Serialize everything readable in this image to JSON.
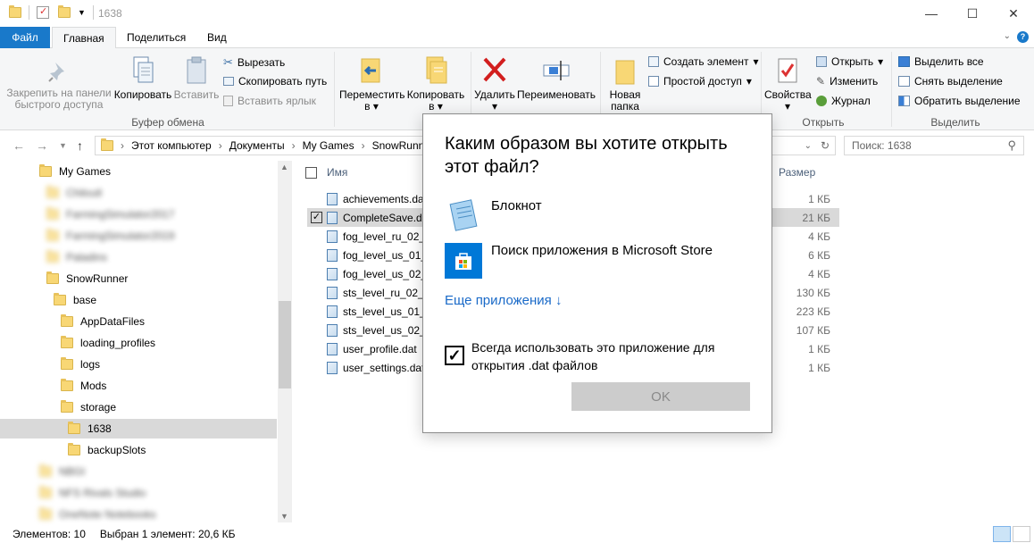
{
  "window": {
    "title": "1638",
    "controls": {
      "minimize": "—",
      "maximize": "☐",
      "close": "✕"
    }
  },
  "tabs": {
    "file": "Файл",
    "home": "Главная",
    "share": "Поделиться",
    "view": "Вид"
  },
  "ribbon": {
    "clipboard": {
      "pin": "Закрепить на панели быстрого доступа",
      "copy": "Копировать",
      "paste": "Вставить",
      "cut": "Вырезать",
      "copy_path": "Скопировать путь",
      "paste_shortcut": "Вставить ярлык",
      "label": "Буфер обмена"
    },
    "organize": {
      "move": "Переместить в",
      "copy_to": "Копировать в",
      "delete": "Удалить",
      "rename": "Переименовать"
    },
    "create": {
      "new_folder": "Новая папка",
      "new_item": "Создать элемент",
      "easy_access": "Простой доступ"
    },
    "open": {
      "properties": "Свойства",
      "open": "Открыть",
      "edit": "Изменить",
      "history": "Журнал",
      "label": "Открыть"
    },
    "select": {
      "select_all": "Выделить все",
      "select_none": "Снять выделение",
      "invert": "Обратить выделение",
      "label": "Выделить"
    }
  },
  "address": {
    "crumbs": [
      "Этот компьютер",
      "Документы",
      "My Games",
      "SnowRunner"
    ],
    "search_placeholder": "Поиск: 1638"
  },
  "tree": [
    {
      "label": "My Games",
      "indent": 0,
      "blur": false,
      "selected": false
    },
    {
      "label": "Chiloutl",
      "indent": 1,
      "blur": true,
      "selected": false
    },
    {
      "label": "FarmingSimulator2017",
      "indent": 1,
      "blur": true,
      "selected": false
    },
    {
      "label": "FarmingSimulator2019",
      "indent": 1,
      "blur": true,
      "selected": false
    },
    {
      "label": "Paladins",
      "indent": 1,
      "blur": true,
      "selected": false
    },
    {
      "label": "SnowRunner",
      "indent": 1,
      "blur": false,
      "selected": false
    },
    {
      "label": "base",
      "indent": 2,
      "blur": false,
      "selected": false
    },
    {
      "label": "AppDataFiles",
      "indent": 3,
      "blur": false,
      "selected": false
    },
    {
      "label": "loading_profiles",
      "indent": 3,
      "blur": false,
      "selected": false
    },
    {
      "label": "logs",
      "indent": 3,
      "blur": false,
      "selected": false
    },
    {
      "label": "Mods",
      "indent": 3,
      "blur": false,
      "selected": false
    },
    {
      "label": "storage",
      "indent": 3,
      "blur": false,
      "selected": false
    },
    {
      "label": "1638",
      "indent": 4,
      "blur": false,
      "selected": true
    },
    {
      "label": "backupSlots",
      "indent": 4,
      "blur": false,
      "selected": false
    },
    {
      "label": "NBGI",
      "indent": 0,
      "blur": true,
      "selected": false
    },
    {
      "label": "NFS Rivals Studio",
      "indent": 0,
      "blur": true,
      "selected": false
    },
    {
      "label": "OneNote Notebooks",
      "indent": 0,
      "blur": true,
      "selected": false
    }
  ],
  "list": {
    "col_name": "Имя",
    "col_size": "Размер",
    "files": [
      {
        "name": "achievements.dat",
        "size": "1 КБ",
        "selected": false,
        "checked": false
      },
      {
        "name": "CompleteSave.dat",
        "size": "21 КБ",
        "selected": true,
        "checked": true
      },
      {
        "name": "fog_level_ru_02_0",
        "size": "4 КБ",
        "selected": false,
        "checked": false
      },
      {
        "name": "fog_level_us_01_0",
        "size": "6 КБ",
        "selected": false,
        "checked": false
      },
      {
        "name": "fog_level_us_02_0",
        "size": "4 КБ",
        "selected": false,
        "checked": false
      },
      {
        "name": "sts_level_ru_02_0",
        "size": "130 КБ",
        "selected": false,
        "checked": false
      },
      {
        "name": "sts_level_us_01_0",
        "size": "223 КБ",
        "selected": false,
        "checked": false
      },
      {
        "name": "sts_level_us_02_0",
        "size": "107 КБ",
        "selected": false,
        "checked": false
      },
      {
        "name": "user_profile.dat",
        "size": "1 КБ",
        "selected": false,
        "checked": false
      },
      {
        "name": "user_settings.dat",
        "size": "1 КБ",
        "selected": false,
        "checked": false
      }
    ]
  },
  "status": {
    "count": "Элементов: 10",
    "selected": "Выбран 1 элемент: 20,6 КБ"
  },
  "dialog": {
    "title": "Каким образом вы хотите открыть этот файл?",
    "app1": "Блокнот",
    "app2": "Поиск приложения в Microsoft Store",
    "more": "Еще приложения ↓",
    "always": "Всегда использовать это приложение для открытия .dat файлов",
    "ok": "OK"
  },
  "colors": {
    "accent": "#1979ca",
    "link": "#1a6ac8",
    "folder": "#f8d775",
    "selection": "#d9d9d9"
  }
}
